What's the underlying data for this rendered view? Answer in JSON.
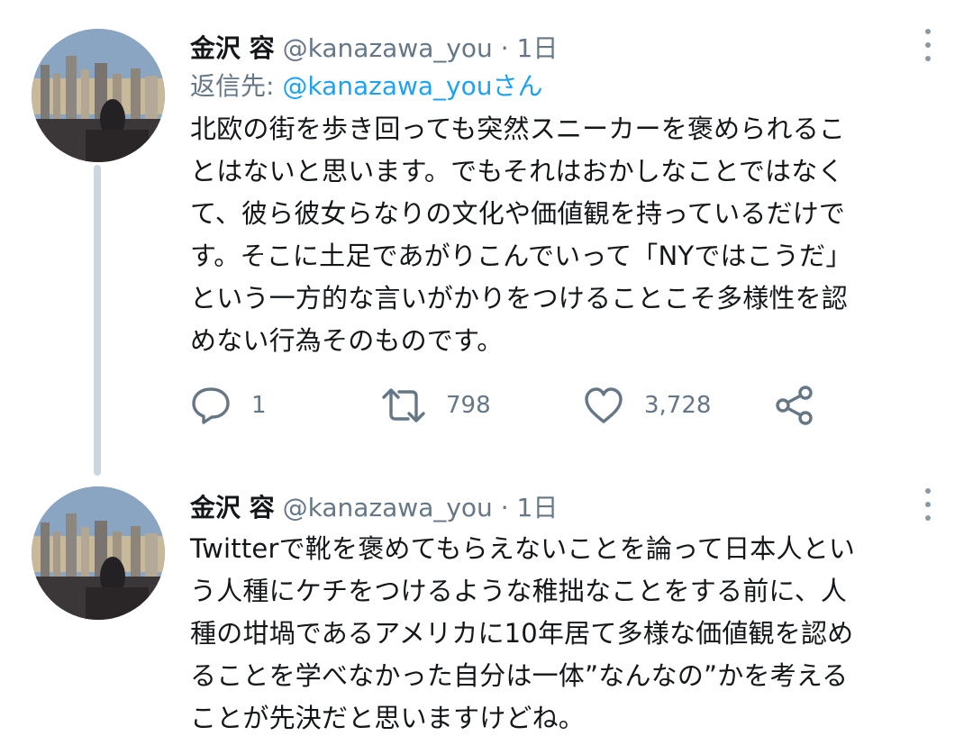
{
  "tweets": [
    {
      "name": "金沢 容",
      "handle": "@kanazawa_you",
      "dot": "·",
      "time": "1日",
      "replying_prefix": "返信先: ",
      "replying_mention": "@kanazawa_youさん",
      "lines": [
        "北欧の街を歩き回っても突然スニーカーを褒められるこ",
        "とはないと思います。でもそれはおかしなことではなく",
        "て、彼ら彼女らなりの文化や価値観を持っているだけで",
        "す。そこに土足であがりこんでいって「NYではこうだ」",
        "という一方的な言いがかりをつけることこそ多様性を認",
        "めない行為そのものです。"
      ],
      "reply_count": "1",
      "retweet_count": "798",
      "like_count": "3,728",
      "icons": [
        "reply-icon",
        "retweet-icon",
        "like-icon",
        "share-icon",
        "more-icon"
      ]
    },
    {
      "name": "金沢 容",
      "handle": "@kanazawa_you",
      "dot": "·",
      "time": "1日",
      "lines": [
        "Twitterで靴を褒めてもらえないことを論って日本人とい",
        "う人種にケチをつけるような稚拙なことをする前に、人",
        "種の坩堝であるアメリカに10年居て多様な価値観を認め",
        "ることを学べなかった自分は一体”なんなの”かを考える",
        "ことが先決だと思いますけどね。"
      ]
    }
  ],
  "colors": {
    "text": "#14171a",
    "secondary": "#657786",
    "link": "#1da1f2",
    "thread_line": "#ccd6dd"
  }
}
